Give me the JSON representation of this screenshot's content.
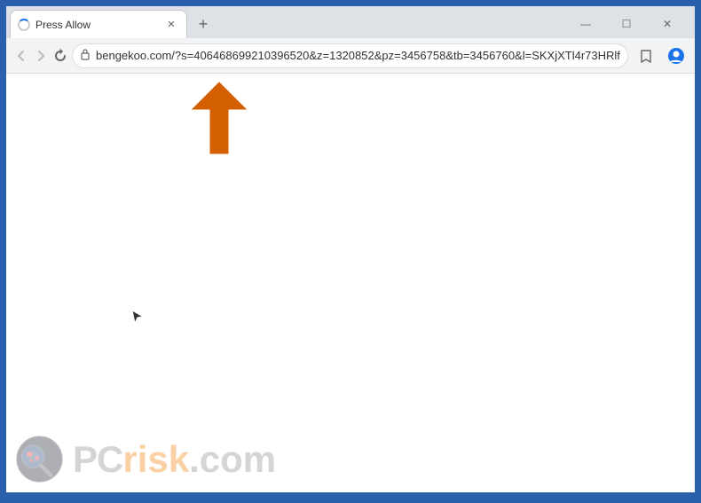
{
  "browser": {
    "tab": {
      "title": "Press Allow",
      "favicon": "loading"
    },
    "new_tab_label": "+",
    "window_controls": {
      "minimize": "—",
      "maximize": "☐",
      "close": "✕"
    },
    "toolbar": {
      "back_label": "←",
      "forward_label": "→",
      "reload_label": "✕",
      "address": "bengekoo.com/?s=406468699210396520&z=1320852&pz=3456758&tb=3456760&l=SKXjXTl4r73HRlf",
      "lock_icon": "🔒",
      "bookmark_icon": "☆",
      "profile_icon": "👤",
      "menu_icon": "⋮"
    },
    "page": {
      "arrow_alt": "orange arrow pointing up-right",
      "cursor_symbol": "↖"
    },
    "watermark": {
      "pc_text": "PC",
      "risk_text": "risk",
      "domain_text": ".com"
    }
  }
}
